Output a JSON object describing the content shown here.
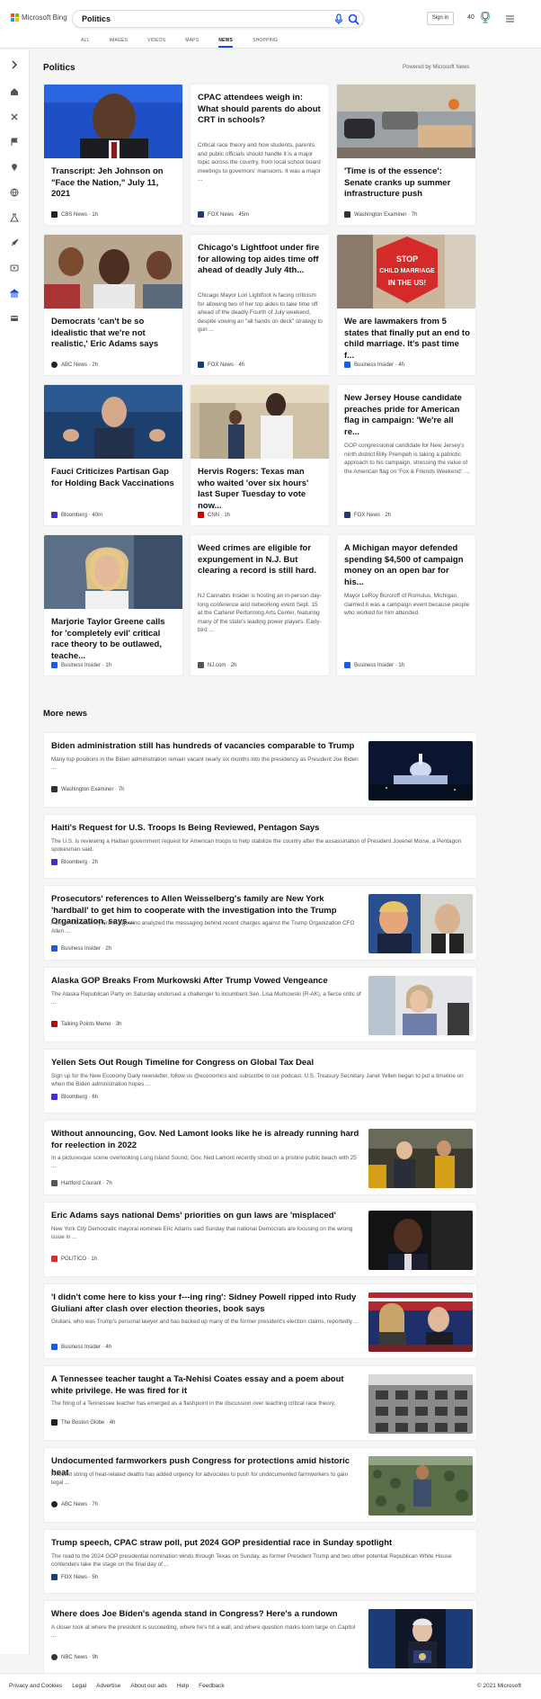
{
  "header": {
    "logo_text": "Microsoft Bing",
    "search_value": "Politics",
    "signin_label": "Sign in",
    "rewards_count": "40",
    "tabs": [
      {
        "label": "ALL",
        "active": false
      },
      {
        "label": "IMAGES",
        "active": false
      },
      {
        "label": "VIDEOS",
        "active": false
      },
      {
        "label": "MAPS",
        "active": false
      },
      {
        "label": "NEWS",
        "active": true
      },
      {
        "label": "SHOPPING",
        "active": false
      }
    ],
    "colors": {
      "accent": "#174ae4"
    }
  },
  "sidebar": {
    "icons": [
      "expand-arrow-icon",
      "home-icon",
      "tools-icon",
      "flag-icon",
      "location-icon",
      "globe-icon",
      "science-icon",
      "rocket-icon",
      "video-icon",
      "bank-icon",
      "card-icon"
    ]
  },
  "section": {
    "title": "Politics",
    "powered_by": "Powered by Microsoft News"
  },
  "cards": [
    {
      "title": "Transcript: Jeh Johnson on \"Face the Nation,\" July 11, 2021",
      "desc": "",
      "source": "CBS News · 1h",
      "src_color": "#222"
    },
    {
      "title": "CPAC attendees weigh in: What should parents do about CRT in schools?",
      "desc": "Critical race theory and how students, parents and public officials should handle it is a major topic across the country, from local school board meetings to governors' mansions. It was a major ...",
      "source": "FOX News · 45m",
      "src_color": "#1a3c7a"
    },
    {
      "title": "'Time is of the essence': Senate cranks up summer infrastructure push",
      "desc": "",
      "source": "Washington Examiner · 7h",
      "src_color": "#333"
    },
    {
      "title": "Democrats 'can't be so idealistic that we're not realistic,' Eric Adams says",
      "desc": "",
      "source": "ABC News · 2h",
      "src_color": "#222"
    },
    {
      "title": "Chicago's Lightfoot under fire for allowing top aides time off ahead of deadly July 4th...",
      "desc": "Chicago Mayor Lori Lightfoot is facing criticism for allowing two of her top aides to take time off ahead of the deadly Fourth of July weekend, despite vowing an \"all hands on deck\" strategy to gun ...",
      "source": "FOX News · 4h",
      "src_color": "#1a3c7a"
    },
    {
      "title": "We are lawmakers from 5 states that finally put an end to child marriage. It's past time f...",
      "desc": "",
      "source": "Business Insider · 4h",
      "src_color": "#1a5be8"
    },
    {
      "title": "Fauci Criticizes Partisan Gap for Holding Back Vaccinations",
      "desc": "",
      "source": "Bloomberg · 40m",
      "src_color": "#4a2ad6"
    },
    {
      "title": "Hervis Rogers: Texas man who waited 'over six hours' last Super Tuesday to vote now...",
      "desc": "",
      "source": "CNN · 1h",
      "src_color": "#c00"
    },
    {
      "title": "New Jersey House candidate preaches pride for American flag in campaign: 'We're all re...",
      "desc": "GOP congressional candidate for New Jersey's ninth district Billy Prempeh is taking a patriotic approach to his campaign, stressing the value of the American flag on 'Fox & Friends Weekend'. ...",
      "source": "FOX News · 2h",
      "src_color": "#1a3c7a"
    },
    {
      "title": "Marjorie Taylor Greene calls for 'completely evil' critical race theory to be outlawed, teache...",
      "desc": "",
      "source": "Business Insider · 1h",
      "src_color": "#1a5be8"
    },
    {
      "title": "Weed crimes are eligible for expungement in N.J. But clearing a record is still hard.",
      "desc": "NJ Cannabis Insider is hosting an in-person day-long conference and networking event Sept. 15 at the Carteret Performing Arts Center, featuring many of the state's leading power players. Early-bird ...",
      "source": "NJ.com · 2h",
      "src_color": "#555"
    },
    {
      "title": "A Michigan mayor defended spending $4,500 of campaign money on an open bar for his...",
      "desc": "Mayor LeRoy Burcroff of Romulus, Michigan, claimed it was a campaign event because people who worked for him attended.",
      "source": "Business Insider · 1h",
      "src_color": "#1a5be8"
    }
  ],
  "more_news": {
    "title": "More news",
    "items": [
      {
        "title": "Biden administration still has hundreds of vacancies comparable to Trump",
        "desc": "Many top positions in the Biden administration remain vacant nearly six months into the presidency as President Joe Biden ...",
        "source": "Washington Examiner · 7h",
        "src_color": "#333"
      },
      {
        "title": "Haiti's Request for U.S. Troops Is Being Reviewed, Pentagon Says",
        "desc": "The U.S. is reviewing a Haitian government request for American troops to help stabilize the country after the assassination of President Jovenel Moise, a Pentagon spokesman said.",
        "source": "Bloomberg · 2h",
        "src_color": "#4a2ad6"
      },
      {
        "title": "Prosecutors' references to Allen Weisselberg's family are New York 'hardball' to get him to cooperate with the investigation into the Trump Organization, says...",
        "desc": "Former US attorney Frank Agostino analyzed the messaging behind recent charges against the Trump Organization CFO Allen ...",
        "source": "Business Insider · 2h",
        "src_color": "#1a5be8"
      },
      {
        "title": "Alaska GOP Breaks From Murkowski After Trump Vowed Vengeance",
        "desc": "The Alaska Republican Party on Saturday endorsed a challenger to incumbent Sen. Lisa Murkowski (R-AK), a fierce critic of ...",
        "source": "Talking Points Memo · 3h",
        "src_color": "#c00"
      },
      {
        "title": "Yellen Sets Out Rough Timeline for Congress on Global Tax Deal",
        "desc": "Sign up for the New Economy Daily newsletter, follow us @economics and subscribe to our podcast. U.S. Treasury Secretary Janet Yellen began to put a timeline on when the Biden administration hopes ...",
        "source": "Bloomberg · 6h",
        "src_color": "#4a2ad6"
      },
      {
        "title": "Without announcing, Gov. Ned Lamont looks like he is already running hard for reelection in 2022",
        "desc": "In a picturesque scene overlooking Long Island Sound, Gov. Ned Lamont recently stood on a pristine public beach with 25 ...",
        "source": "Hartford Courant · 7h",
        "src_color": "#555"
      },
      {
        "title": "Eric Adams says national Dems' priorities on gun laws are 'misplaced'",
        "desc": "New York City Democratic mayoral nominee Eric Adams said Sunday that national Democrats are focusing on the wrong issue in ...",
        "source": "POLITICO · 1h",
        "src_color": "#d92c2c"
      },
      {
        "title": "'I didn't come here to kiss your f---ing ring': Sidney Powell ripped into Rudy Giuliani after clash over election theories, book says",
        "desc": "Giuliani, who was Trump's personal lawyer and has backed up many of the former president's election claims, reportedly ...",
        "source": "Business Insider · 4h",
        "src_color": "#1a5be8"
      },
      {
        "title": "A Tennessee teacher taught a Ta-Nehisi Coates essay and a poem about white privilege. He was fired for it",
        "desc": "The firing of a Tennessee teacher has emerged as a flashpoint in the discussion over teaching critical race theory.",
        "source": "The Boston Globe · 4h",
        "src_color": "#222"
      },
      {
        "title": "Undocumented farmworkers push Congress for protections amid historic heat",
        "desc": "A recent string of heat-related deaths has added urgency for advocates to push for undocumented farmworkers to gain legal ...",
        "source": "ABC News · 7h",
        "src_color": "#222"
      },
      {
        "title": "Trump speech, CPAC straw poll, put 2024 GOP presidential race in Sunday spotlight",
        "desc": "The road to the 2024 GOP presidential nomination winds through Texas on Sunday, as former President Trump and two other potential Republican White House contenders take the stage on the final day of ...",
        "source": "FOX News · 5h",
        "src_color": "#1a3c7a"
      },
      {
        "title": "Where does Joe Biden's agenda stand in Congress? Here's a rundown",
        "desc": "A closer look at where the president is succeeding, where he's hit a wall, and where question marks loom large on Capitol ...",
        "source": "NBC News · 9h",
        "src_color": "#333"
      }
    ]
  },
  "footer": {
    "links": [
      "Privacy and Cookies",
      "Legal",
      "Advertise",
      "About our ads",
      "Help",
      "Feedback"
    ],
    "copyright": "© 2021 Microsoft"
  }
}
